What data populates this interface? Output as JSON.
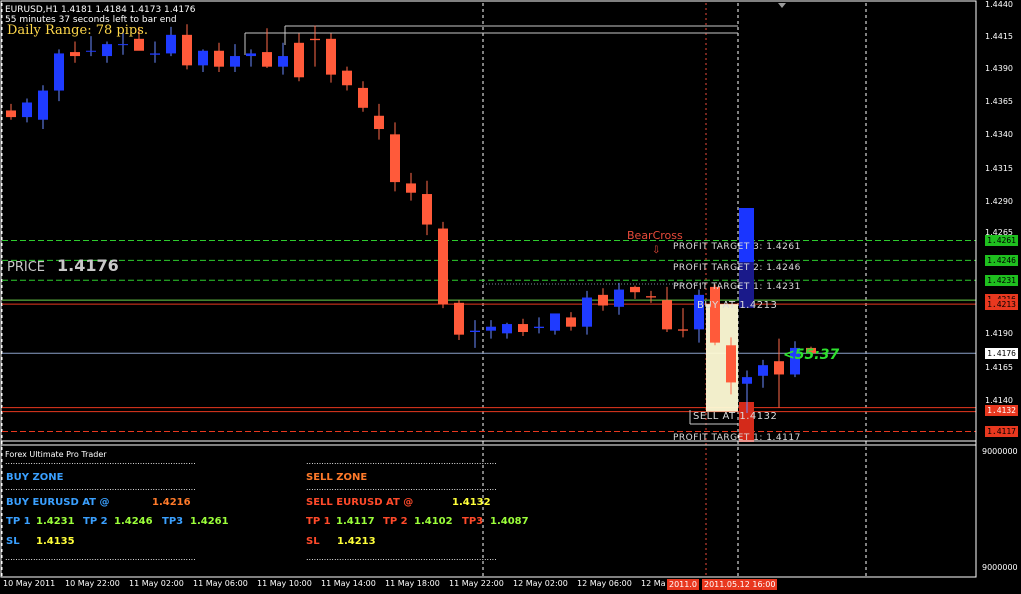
{
  "header": {
    "symbol_line": "EURUSD,H1  1.4181 1.4184 1.4173 1.4176",
    "bar_timer": "55 minutes 37 seconds left to bar end",
    "daily_range": "Daily Range: 78 pips."
  },
  "price_display": {
    "label": "PRICE",
    "value": "1.4176"
  },
  "bear_cross": "BearCross",
  "profit_targets": {
    "buy": [
      "PROFIT TARGET 3: 1.4261",
      "PROFIT TARGET 2: 1.4246",
      "PROFIT TARGET 1: 1.4231"
    ],
    "sell": "PROFIT TARGET 1: 1.4117"
  },
  "overlay_labels": {
    "buy_at": "BUY AT 1.4213",
    "sell_at": "SELL AT 1.4132"
  },
  "timer": "<55:37",
  "y_axis": {
    "ticks": [
      "1.4440",
      "1.4415",
      "1.4390",
      "1.4365",
      "1.4340",
      "1.4315",
      "1.4290",
      "1.4265",
      "1.4190",
      "1.4165",
      "1.4140"
    ],
    "boxes": [
      {
        "label": "1.4261",
        "color": "#1fbf1f",
        "text": "#000"
      },
      {
        "label": "1.4246",
        "color": "#1fbf1f",
        "text": "#000"
      },
      {
        "label": "1.4231",
        "color": "#1fbf1f",
        "text": "#000"
      },
      {
        "label": "1.4216",
        "color": "#e8381f",
        "text": "#000"
      },
      {
        "label": "1.4213",
        "color": "#e8381f",
        "text": "#000"
      },
      {
        "label": "1.4176",
        "color": "#ffffff",
        "text": "#000"
      },
      {
        "label": "1.4132",
        "color": "#e8381f",
        "text": "#fff"
      },
      {
        "label": "1.4117",
        "color": "#e8381f",
        "text": "#000"
      }
    ],
    "sub_ticks": [
      "9000000",
      "9000000"
    ]
  },
  "x_axis": {
    "labels": [
      "10 May 2011",
      "10 May 22:00",
      "11 May 02:00",
      "11 May 06:00",
      "11 May 10:00",
      "11 May 14:00",
      "11 May 18:00",
      "11 May 22:00",
      "12 May 02:00",
      "12 May 06:00",
      "12 Ma"
    ],
    "current_datetime": "2011.05.12 16:00",
    "partial_datetime": "2011.0"
  },
  "panel": {
    "title": "Forex Ultimate Pro Trader",
    "buy_zone": {
      "title": "BUY ZONE",
      "at_label": "BUY EURUSD AT @",
      "at_value": "1.4216",
      "tp1_label": "TP 1",
      "tp1_value": "1.4231",
      "tp2_label": "TP 2",
      "tp2_value": "1.4246",
      "tp3_label": "TP3",
      "tp3_value": "1.4261",
      "sl_label": "SL",
      "sl_value": "1.4135"
    },
    "sell_zone": {
      "title": "SELL ZONE",
      "at_label": "SELL EURUSD AT @",
      "at_value": "1.4132",
      "tp1_label": "TP 1",
      "tp1_value": "1.4117",
      "tp2_label": "TP 2",
      "tp2_value": "1.4102",
      "tp3_label": "TP3",
      "tp3_value": "1.4087",
      "sl_label": "SL",
      "sl_value": "1.4213"
    },
    "dots": "............................................................................................"
  },
  "chart_data": {
    "type": "candlestick",
    "symbol": "EURUSD",
    "timeframe": "H1",
    "candles": [
      {
        "o": 1.4359,
        "h": 1.4364,
        "l": 1.4352,
        "c": 1.4354
      },
      {
        "o": 1.4354,
        "h": 1.4368,
        "l": 1.435,
        "c": 1.4365
      },
      {
        "o": 1.4352,
        "h": 1.4378,
        "l": 1.4345,
        "c": 1.4374
      },
      {
        "o": 1.4374,
        "h": 1.4405,
        "l": 1.4366,
        "c": 1.4402
      },
      {
        "o": 1.4403,
        "h": 1.4411,
        "l": 1.4395,
        "c": 1.44
      },
      {
        "o": 1.4404,
        "h": 1.4415,
        "l": 1.44,
        "c": 1.4404
      },
      {
        "o": 1.44,
        "h": 1.4411,
        "l": 1.4395,
        "c": 1.4409
      },
      {
        "o": 1.4409,
        "h": 1.4419,
        "l": 1.4401,
        "c": 1.4409
      },
      {
        "o": 1.4413,
        "h": 1.4422,
        "l": 1.4405,
        "c": 1.4404
      },
      {
        "o": 1.4401,
        "h": 1.4411,
        "l": 1.4395,
        "c": 1.4402
      },
      {
        "o": 1.4402,
        "h": 1.4422,
        "l": 1.44,
        "c": 1.4416
      },
      {
        "o": 1.4416,
        "h": 1.4424,
        "l": 1.439,
        "c": 1.4393
      },
      {
        "o": 1.4393,
        "h": 1.4405,
        "l": 1.4388,
        "c": 1.4404
      },
      {
        "o": 1.4404,
        "h": 1.441,
        "l": 1.4388,
        "c": 1.4392
      },
      {
        "o": 1.4392,
        "h": 1.4409,
        "l": 1.4388,
        "c": 1.44
      },
      {
        "o": 1.44,
        "h": 1.4405,
        "l": 1.4392,
        "c": 1.4402
      },
      {
        "o": 1.4403,
        "h": 1.4421,
        "l": 1.4391,
        "c": 1.4392
      },
      {
        "o": 1.4392,
        "h": 1.441,
        "l": 1.4386,
        "c": 1.44
      },
      {
        "o": 1.441,
        "h": 1.4417,
        "l": 1.4381,
        "c": 1.4384
      },
      {
        "o": 1.4413,
        "h": 1.4423,
        "l": 1.4392,
        "c": 1.4412
      },
      {
        "o": 1.4413,
        "h": 1.4417,
        "l": 1.438,
        "c": 1.4386
      },
      {
        "o": 1.4389,
        "h": 1.4392,
        "l": 1.4374,
        "c": 1.4378
      },
      {
        "o": 1.4376,
        "h": 1.4381,
        "l": 1.4358,
        "c": 1.4361
      },
      {
        "o": 1.4355,
        "h": 1.4364,
        "l": 1.4337,
        "c": 1.4345
      },
      {
        "o": 1.4341,
        "h": 1.435,
        "l": 1.4298,
        "c": 1.4305
      },
      {
        "o": 1.4304,
        "h": 1.4312,
        "l": 1.4291,
        "c": 1.4297
      },
      {
        "o": 1.4296,
        "h": 1.4306,
        "l": 1.4265,
        "c": 1.4273
      },
      {
        "o": 1.427,
        "h": 1.4275,
        "l": 1.421,
        "c": 1.4213
      },
      {
        "o": 1.4214,
        "h": 1.4216,
        "l": 1.4186,
        "c": 1.419
      },
      {
        "o": 1.4192,
        "h": 1.4201,
        "l": 1.418,
        "c": 1.4193
      },
      {
        "o": 1.4193,
        "h": 1.4201,
        "l": 1.4187,
        "c": 1.4196
      },
      {
        "o": 1.4191,
        "h": 1.4199,
        "l": 1.4187,
        "c": 1.4198
      },
      {
        "o": 1.4198,
        "h": 1.4202,
        "l": 1.4189,
        "c": 1.4192
      },
      {
        "o": 1.4195,
        "h": 1.4203,
        "l": 1.4191,
        "c": 1.4196
      },
      {
        "o": 1.4193,
        "h": 1.4206,
        "l": 1.419,
        "c": 1.4206
      },
      {
        "o": 1.4203,
        "h": 1.4207,
        "l": 1.4193,
        "c": 1.4196
      },
      {
        "o": 1.4196,
        "h": 1.4223,
        "l": 1.419,
        "c": 1.4218
      },
      {
        "o": 1.422,
        "h": 1.4225,
        "l": 1.4208,
        "c": 1.4212
      },
      {
        "o": 1.4211,
        "h": 1.4229,
        "l": 1.4205,
        "c": 1.4224
      },
      {
        "o": 1.4226,
        "h": 1.4227,
        "l": 1.4217,
        "c": 1.4222
      },
      {
        "o": 1.4219,
        "h": 1.4223,
        "l": 1.4214,
        "c": 1.4218
      },
      {
        "o": 1.4216,
        "h": 1.4226,
        "l": 1.4192,
        "c": 1.4194
      },
      {
        "o": 1.4194,
        "h": 1.421,
        "l": 1.4188,
        "c": 1.4193
      },
      {
        "o": 1.4194,
        "h": 1.4224,
        "l": 1.4184,
        "c": 1.422
      },
      {
        "o": 1.4226,
        "h": 1.4228,
        "l": 1.4182,
        "c": 1.4184
      },
      {
        "o": 1.4182,
        "h": 1.4188,
        "l": 1.4145,
        "c": 1.4154
      },
      {
        "o": 1.4153,
        "h": 1.4163,
        "l": 1.4131,
        "c": 1.4158
      },
      {
        "o": 1.4159,
        "h": 1.4171,
        "l": 1.415,
        "c": 1.4167
      },
      {
        "o": 1.417,
        "h": 1.4187,
        "l": 1.4135,
        "c": 1.416
      },
      {
        "o": 1.416,
        "h": 1.4185,
        "l": 1.4158,
        "c": 1.418
      },
      {
        "o": 1.418,
        "h": 1.4181,
        "l": 1.4173,
        "c": 1.4176
      }
    ]
  }
}
